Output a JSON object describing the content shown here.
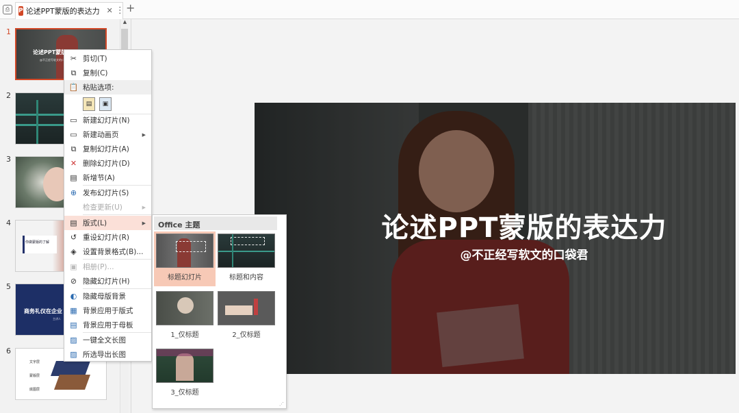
{
  "tab": {
    "title": "论述PPT蒙版的表达力",
    "close": "✕",
    "more": "⋮",
    "add": "+"
  },
  "thumbnails": [
    {
      "num": "1",
      "title": "论述PPT蒙版",
      "sub": "@不正经写软文的口袋君"
    },
    {
      "num": "2"
    },
    {
      "num": "3"
    },
    {
      "num": "4",
      "title": "你做蒙版的了解"
    },
    {
      "num": "5",
      "title": "商务礼仪在企业",
      "sub": "主讲人"
    },
    {
      "num": "6",
      "labels": [
        "文字层",
        "蒙版层",
        "底图层"
      ]
    }
  ],
  "slide": {
    "title": "论述PPT蒙版的表达力",
    "subtitle": "@不正经写软文的口袋君"
  },
  "context_menu": {
    "cut": "剪切(T)",
    "copy": "复制(C)",
    "paste_options": "粘贴选项:",
    "new_slide": "新建幻灯片(N)",
    "new_anim_page": "新建动画页",
    "duplicate_slide": "复制幻灯片(A)",
    "delete_slide": "删除幻灯片(D)",
    "new_section": "新增节(A)",
    "publish_slide": "发布幻灯片(S)",
    "check_update": "检查更新(U)",
    "layout": "版式(L)",
    "reset_slide": "重设幻灯片(R)",
    "format_background": "设置背景格式(B)...",
    "photo_album": "相册(P)...",
    "hide_slide": "隐藏幻灯片(H)",
    "hide_master_bg": "隐藏母版背景",
    "apply_bg_layout": "背景应用于版式",
    "apply_bg_master": "背景应用于母板",
    "one_click_long": "一键全文长图",
    "export_selected_long": "所选导出长图"
  },
  "layout_menu": {
    "header": "Office 主题",
    "layouts": [
      "标题幻灯片",
      "标题和内容",
      "1_仅标题",
      "2_仅标题",
      "3_仅标题"
    ]
  },
  "colors": {
    "accent": "#d24726",
    "highlight": "#fbe0d8",
    "selected_layout": "#f7c9b6"
  }
}
